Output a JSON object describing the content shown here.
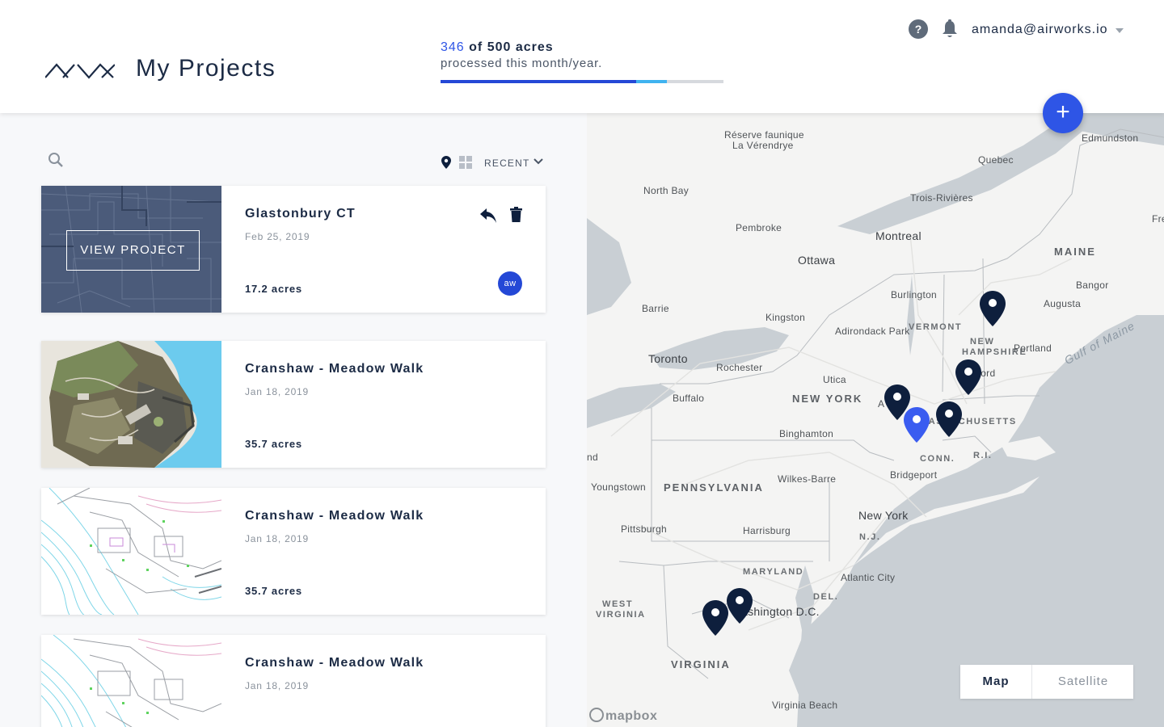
{
  "header": {
    "page_title": "My Projects",
    "usage": {
      "processed": "346",
      "limit_text": "of 500 acres",
      "caption": "processed this month/year.",
      "processed_fraction": 0.692,
      "extra_fraction": 0.108
    },
    "help_label": "?",
    "user_email": "amanda@airworks.io",
    "add_label": "+"
  },
  "toolbar": {
    "sort_label": "RECENT"
  },
  "projects": [
    {
      "name": "Glastonbury CT",
      "date": "Feb 25, 2019",
      "acres": "17.2 acres",
      "view_label": "VIEW PROJECT",
      "owner_initials": "aw"
    },
    {
      "name": "Cranshaw - Meadow Walk",
      "date": "Jan 18, 2019",
      "acres": "35.7 acres"
    },
    {
      "name": "Cranshaw - Meadow Walk",
      "date": "Jan 18, 2019",
      "acres": "35.7 acres"
    },
    {
      "name": "Cranshaw - Meadow Walk",
      "date": "Jan 18, 2019",
      "acres": ""
    }
  ],
  "map": {
    "labels": {
      "reserve1": "Réserve faunique",
      "reserve2": "La Vérendrye",
      "edmundston": "Edmundston",
      "quebec": "Quebec",
      "north_bay": "North Bay",
      "trois": "Trois-Rivières",
      "pembroke": "Pembroke",
      "montreal": "Montreal",
      "ottawa": "Ottawa",
      "maine": "MAINE",
      "bangor": "Bangor",
      "burlington": "Burlington",
      "augusta": "Augusta",
      "barrie": "Barrie",
      "kingston": "Kingston",
      "adirondack": "Adirondack Park",
      "vermont": "VERMONT",
      "new_hampshire1": "NEW",
      "new_hampshire2": "HAMPSHIRE",
      "portland": "Portland",
      "gulf": "Gulf of Maine",
      "toronto": "Toronto",
      "rochester": "Rochester",
      "concord": "Concord",
      "utica": "Utica",
      "buffalo": "Buffalo",
      "new_york_state": "NEW YORK",
      "albany": "A",
      "massachusetts": "MASSACHUSETTS",
      "binghamton": "Binghamton",
      "conn": "CONN.",
      "ri": "R.I.",
      "nd": "nd",
      "bridgeport": "Bridgeport",
      "youngstown": "Youngstown",
      "pennsylvania": "PENNSYLVANIA",
      "wilkes_barre": "Wilkes-Barre",
      "new_york_city": "New York",
      "pittsburgh": "Pittsburgh",
      "harrisburg": "Harrisburg",
      "nj": "N.J.",
      "maryland": "MARYLAND",
      "atlantic_city": "Atlantic City",
      "del": "DEL.",
      "west_virginia1": "WEST",
      "west_virginia2": "VIRGINIA",
      "washington": "Washington D.C.",
      "virginia": "VIRGINIA",
      "virginia_beach": "Virginia Beach",
      "fre": "Fre"
    },
    "toggle_map": "Map",
    "toggle_satellite": "Satellite",
    "attribution": "mapbox"
  },
  "colors": {
    "accent": "#2e55e6",
    "pin_dark": "#0e1f3d",
    "pin_selected": "#3a5cf0",
    "water": "#c7cdd2",
    "land": "#f4f4f3"
  }
}
